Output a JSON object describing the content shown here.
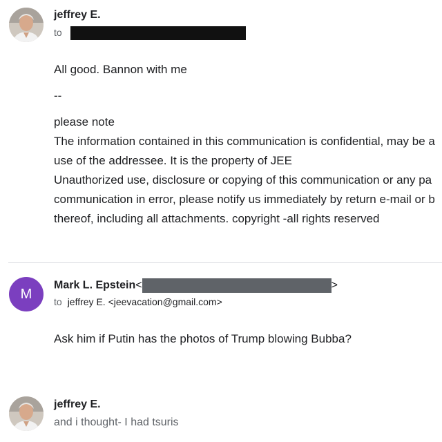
{
  "messages": [
    {
      "sender": "jeffrey E.",
      "to_label": "to",
      "avatar_icon": "person-photo",
      "body": {
        "line1": "All good. Bannon with me",
        "sig_sep": "--",
        "note": "please note",
        "disc1": "The information contained in this communication is confidential, may be a",
        "disc2": "use of the addressee. It is the property of JEE",
        "disc3": "Unauthorized use, disclosure or copying of this communication or any pa",
        "disc4": "communication in error, please notify us immediately by return e-mail or b",
        "disc5": "thereof, including all attachments. copyright -all rights reserved"
      }
    },
    {
      "sender": "Mark L. Epstein",
      "sender_addr_open": "<",
      "sender_addr_close": ">",
      "avatar_letter": "M",
      "avatar_color": "#7b3fbf",
      "to_label": "to",
      "to_value": "jeffrey E. <jeevacation@gmail.com>",
      "body": "Ask him if Putin has the photos of Trump blowing Bubba?"
    },
    {
      "sender": "jeffrey E.",
      "avatar_icon": "person-photo",
      "snippet": "and i thought- I had tsuris"
    }
  ]
}
